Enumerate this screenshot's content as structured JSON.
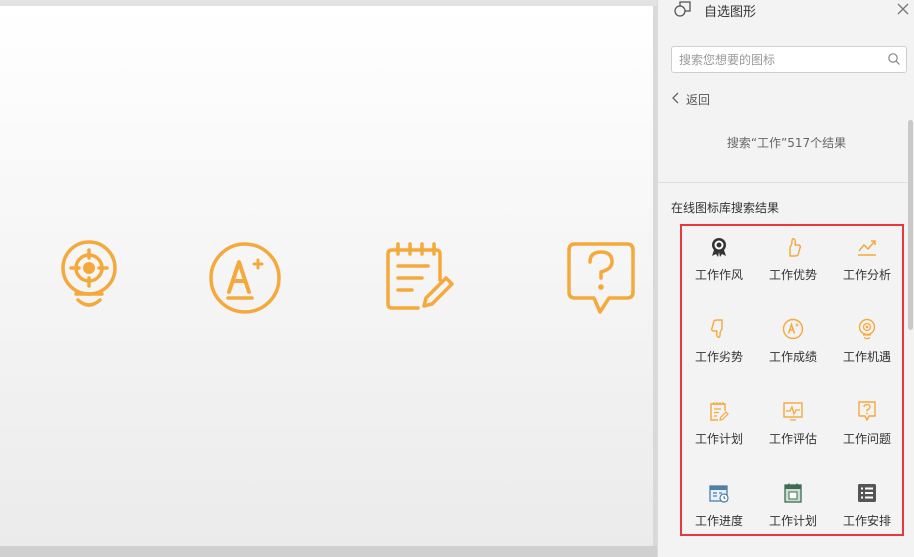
{
  "pane": {
    "title": "自选图形",
    "search": {
      "placeholder": "搜索您想要的图标",
      "value": ""
    },
    "back_label": "返回",
    "result_summary": "搜索“工作”517个结果",
    "section_title": "在线图标库搜索结果",
    "items": [
      {
        "label": "工作作风",
        "icon": "award-badge-icon"
      },
      {
        "label": "工作优势",
        "icon": "thumbs-up-icon"
      },
      {
        "label": "工作分析",
        "icon": "trend-chart-icon"
      },
      {
        "label": "工作劣势",
        "icon": "thumbs-down-icon"
      },
      {
        "label": "工作成绩",
        "icon": "grade-a-plus-icon"
      },
      {
        "label": "工作机遇",
        "icon": "lightbulb-target-icon"
      },
      {
        "label": "工作计划",
        "icon": "notepad-pencil-icon"
      },
      {
        "label": "工作评估",
        "icon": "pulse-monitor-icon"
      },
      {
        "label": "工作问题",
        "icon": "question-bubble-icon"
      },
      {
        "label": "工作进度",
        "icon": "calendar-clock-icon"
      },
      {
        "label": "工作计划",
        "icon": "calendar-page-icon"
      },
      {
        "label": "工作安排",
        "icon": "list-icon"
      }
    ]
  },
  "slide": {
    "icons": [
      "lightbulb-target-icon",
      "grade-a-plus-icon",
      "notepad-pencil-icon",
      "question-bubble-icon"
    ]
  },
  "colors": {
    "accent": "#f5a93b",
    "highlight_border": "#e8383d"
  }
}
